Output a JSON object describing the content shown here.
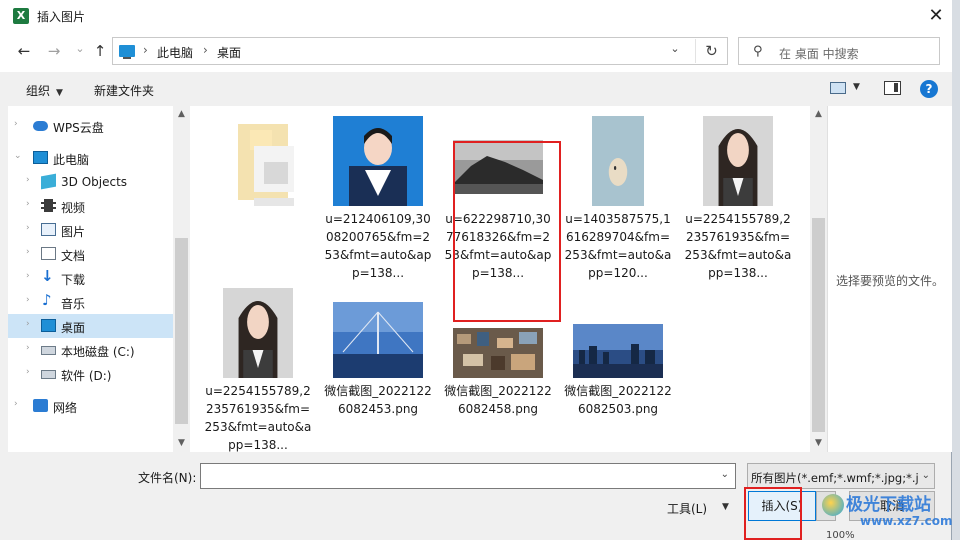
{
  "window": {
    "title": "插入图片",
    "app_icon_letter": "X",
    "close_glyph": "✕"
  },
  "nav": {
    "back": "←",
    "forward": "→",
    "recent": "⌄",
    "up": "↑",
    "breadcrumb": [
      "此电脑",
      "桌面"
    ],
    "separator": "›",
    "dropdown": "⌄",
    "refresh": "↻",
    "search_placeholder": "在 桌面 中搜索",
    "search_icon": "⚲"
  },
  "toolbar": {
    "organize": "组织",
    "new_folder": "新建文件夹",
    "caret": "▼",
    "help": "?"
  },
  "sidebar": {
    "items": [
      {
        "label": "WPS云盘",
        "icon": "cloud-icon",
        "arrow": "›"
      },
      {
        "label": "此电脑",
        "icon": "pc-icon",
        "arrow": "⌄"
      },
      {
        "label": "3D Objects",
        "icon": "3d-objects-icon",
        "arrow": "›"
      },
      {
        "label": "视频",
        "icon": "video-icon",
        "arrow": "›"
      },
      {
        "label": "图片",
        "icon": "pictures-icon",
        "arrow": "›"
      },
      {
        "label": "文档",
        "icon": "documents-icon",
        "arrow": "›"
      },
      {
        "label": "下载",
        "icon": "download-icon",
        "arrow": "›"
      },
      {
        "label": "音乐",
        "icon": "music-icon",
        "arrow": "›"
      },
      {
        "label": "桌面",
        "icon": "desktop-icon",
        "arrow": "›"
      },
      {
        "label": "本地磁盘 (C:)",
        "icon": "disk-icon",
        "arrow": "›"
      },
      {
        "label": "软件 (D:)",
        "icon": "disk-icon",
        "arrow": "›"
      },
      {
        "label": "网络",
        "icon": "network-icon",
        "arrow": "›"
      }
    ]
  },
  "files": [
    {
      "name": "",
      "kind": "folder-blurred"
    },
    {
      "name": "u=212406109,3008200765&fm=253&fmt=auto&app=138...",
      "kind": "portrait-blue"
    },
    {
      "name": "u=622298710,3077618326&fm=253&fmt=auto&app=138...",
      "kind": "landscape-bw"
    },
    {
      "name": "u=1403587575,1616289704&fm=253&fmt=auto&app=120...",
      "kind": "cartoon"
    },
    {
      "name": "u=2254155789,2235761935&fm=253&fmt=auto&app=138...",
      "kind": "portrait-gray"
    },
    {
      "name": "u=2254155789,2235761935&fm=253&fmt=auto&app=138...",
      "kind": "portrait-gray"
    },
    {
      "name": "微信截图_20221226082453.png",
      "kind": "bridge-night"
    },
    {
      "name": "微信截图_20221226082458.png",
      "kind": "city-aerial"
    },
    {
      "name": "微信截图_20221226082503.png",
      "kind": "skyline-dusk"
    }
  ],
  "preview": {
    "text": "选择要预览的文件。"
  },
  "bottom": {
    "filename_label": "文件名(N):",
    "filename_value": "",
    "filter": "所有图片(*.emf;*.wmf;*.jpg;*.jpeg;*.png)",
    "tools": "工具(L)",
    "insert": "插入(S)",
    "cancel": "取消",
    "dropdown": "▼"
  },
  "watermark": {
    "text": "极光下载站",
    "url": "www.xz7.com"
  },
  "status": {
    "zoom": "100%"
  },
  "colors": {
    "highlight_box": "#e02020",
    "selected_row": "#cce4f7",
    "accent": "#0078d7"
  }
}
